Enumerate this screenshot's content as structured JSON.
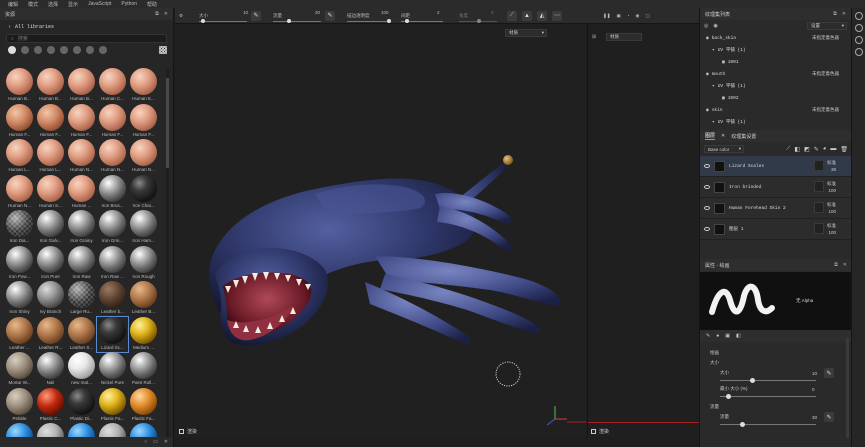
{
  "menubar": {
    "items": [
      "编辑",
      "模式",
      "选择",
      "显示",
      "JavaScript",
      "Python",
      "帮助"
    ]
  },
  "left": {
    "title": "资源",
    "libraries_label": "All libraries",
    "search_placeholder": "搜索",
    "materials": [
      {
        "name": "Human B...",
        "kind": "skin"
      },
      {
        "name": "Human B...",
        "kind": "skin"
      },
      {
        "name": "Human B...",
        "kind": "skin"
      },
      {
        "name": "Human C...",
        "kind": "skin"
      },
      {
        "name": "Human E...",
        "kind": "skin"
      },
      {
        "name": "Human F...",
        "kind": "skin2"
      },
      {
        "name": "Human F...",
        "kind": "skin2"
      },
      {
        "name": "Human F...",
        "kind": "skin"
      },
      {
        "name": "Human F...",
        "kind": "skin"
      },
      {
        "name": "Human F...",
        "kind": "skin"
      },
      {
        "name": "Human L...",
        "kind": "skin"
      },
      {
        "name": "Human L...",
        "kind": "skin"
      },
      {
        "name": "Human N...",
        "kind": "skin"
      },
      {
        "name": "Human N...",
        "kind": "skin"
      },
      {
        "name": "Human N...",
        "kind": "skin"
      },
      {
        "name": "Human N...",
        "kind": "skin"
      },
      {
        "name": "Human S...",
        "kind": "skin"
      },
      {
        "name": "Human ...",
        "kind": "skin"
      },
      {
        "name": "Iron Brus...",
        "kind": "iron"
      },
      {
        "name": "Iron Chai...",
        "kind": "dark"
      },
      {
        "name": "Iron Dia...",
        "kind": "checker"
      },
      {
        "name": "Iron Galv...",
        "kind": "iron"
      },
      {
        "name": "Iron Grainy",
        "kind": "iron"
      },
      {
        "name": "Iron Grin...",
        "kind": "iron"
      },
      {
        "name": "Iron Ham...",
        "kind": "iron"
      },
      {
        "name": "Iron Pow...",
        "kind": "iron"
      },
      {
        "name": "Iron Pure",
        "kind": "iron"
      },
      {
        "name": "Iron Raw",
        "kind": "iron"
      },
      {
        "name": "Iron Raw ...",
        "kind": "iron"
      },
      {
        "name": "Iron Rough",
        "kind": "iron"
      },
      {
        "name": "Iron Shiny",
        "kind": "iron"
      },
      {
        "name": "Ivy Branch",
        "kind": "grey"
      },
      {
        "name": "Large Ru...",
        "kind": "checker"
      },
      {
        "name": "Leather b...",
        "kind": "leatherd"
      },
      {
        "name": "Leather B...",
        "kind": "leather"
      },
      {
        "name": "Leather ...",
        "kind": "leather"
      },
      {
        "name": "Leather R...",
        "kind": "leather"
      },
      {
        "name": "Leather S...",
        "kind": "leather"
      },
      {
        "name": "Lizard Sc...",
        "kind": "dark"
      },
      {
        "name": "Medium ...",
        "kind": "gold"
      },
      {
        "name": "Mortar W...",
        "kind": "stone"
      },
      {
        "name": "Nail",
        "kind": "iron"
      },
      {
        "name": "new mat...",
        "kind": "white"
      },
      {
        "name": "Nickel Pure",
        "kind": "iron"
      },
      {
        "name": "Paint Roll...",
        "kind": "iron"
      },
      {
        "name": "Pebble",
        "kind": "stone"
      },
      {
        "name": "Plastic C...",
        "kind": "red"
      },
      {
        "name": "Plastic Di...",
        "kind": "dark"
      },
      {
        "name": "Plastic Fa...",
        "kind": "gold"
      },
      {
        "name": "Plastic Fa...",
        "kind": "orange"
      },
      {
        "name": "",
        "kind": "blue"
      },
      {
        "name": "",
        "kind": "fur"
      },
      {
        "name": "",
        "kind": "blue"
      },
      {
        "name": "",
        "kind": "fur"
      },
      {
        "name": "",
        "kind": "blue"
      }
    ]
  },
  "toolbar": {
    "size_label": "大小",
    "size_value": "10",
    "flow_label": "流量",
    "flow_value": "30",
    "stroke_opacity_label": "描边透明度",
    "stroke_opacity_value": "100",
    "spacing_label": "间距",
    "spacing_value": "2",
    "angle_label": "角度",
    "angle_value": "0"
  },
  "viewport": {
    "material_dropdown": "材质",
    "bottom_label": "渲染"
  },
  "viewport2": {
    "material_dropdown": "材质",
    "bottom_label": "渲染"
  },
  "texture_set_list": {
    "title": "纹理集列表",
    "settings_label": "设置",
    "items": [
      {
        "name": "back_skin",
        "uv": "UV 平铺 (1)",
        "tile": "1001",
        "assign": "未指定着色器"
      },
      {
        "name": "mouth",
        "uv": "UV 平铺 (1)",
        "tile": "1002",
        "assign": "未指定着色器"
      },
      {
        "name": "skin",
        "uv": "UV 平铺 (1)",
        "tile": "1002",
        "assign": "未指定着色器"
      }
    ]
  },
  "layers_panel": {
    "tab_layers": "图层",
    "tab_texset_settings": "纹理集设置",
    "channel_dropdown": "Base color",
    "layers": [
      {
        "name": "Lizard Scales",
        "blend": "标准",
        "opacity": "38",
        "selected": true
      },
      {
        "name": "Iron brinded",
        "blend": "标准",
        "opacity": "100",
        "selected": false
      },
      {
        "name": "Human Forehead Skin 2",
        "blend": "标准",
        "opacity": "100",
        "selected": false
      },
      {
        "name": "图层 1",
        "blend": "标准",
        "opacity": "100",
        "selected": false
      }
    ]
  },
  "properties": {
    "title": "属性 - 绘画",
    "brush_preview_label": "无 Alpha",
    "section_label": "绘画",
    "size_label": "大小",
    "size_field_label": "大小",
    "size_value": "10",
    "min_size_label": "最小 大小 (%)",
    "min_size_value": "0",
    "flow_section": "流量",
    "flow_label": "流量",
    "flow_value": "30"
  }
}
